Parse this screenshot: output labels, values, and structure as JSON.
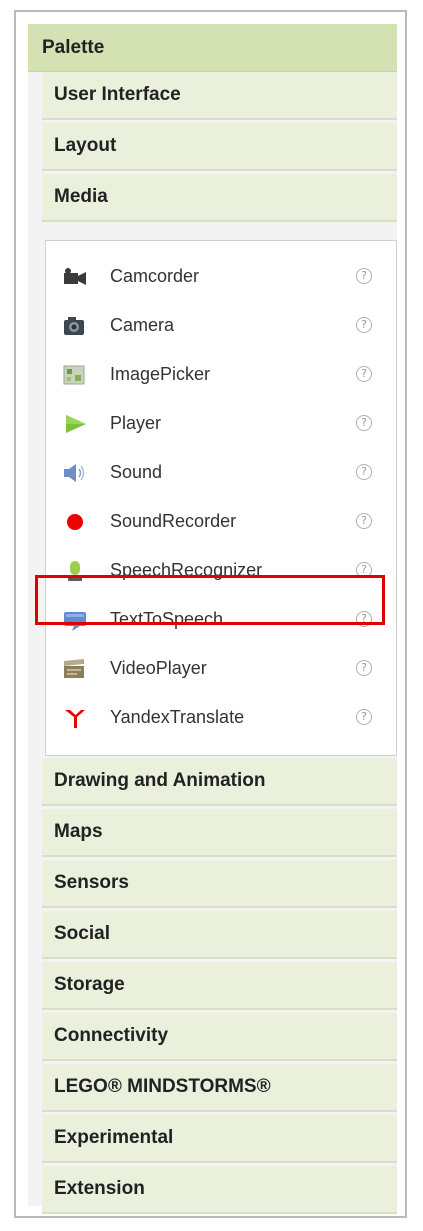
{
  "palette": {
    "title": "Palette"
  },
  "categories_top": [
    "User Interface",
    "Layout",
    "Media"
  ],
  "media_items": [
    {
      "label": "Camcorder",
      "icon": "camcorder-icon"
    },
    {
      "label": "Camera",
      "icon": "camera-icon"
    },
    {
      "label": "ImagePicker",
      "icon": "image-picker-icon"
    },
    {
      "label": "Player",
      "icon": "player-icon"
    },
    {
      "label": "Sound",
      "icon": "sound-icon"
    },
    {
      "label": "SoundRecorder",
      "icon": "sound-recorder-icon"
    },
    {
      "label": "SpeechRecognizer",
      "icon": "speech-recognizer-icon"
    },
    {
      "label": "TextToSpeech",
      "icon": "text-to-speech-icon"
    },
    {
      "label": "VideoPlayer",
      "icon": "video-player-icon"
    },
    {
      "label": "YandexTranslate",
      "icon": "yandex-translate-icon"
    }
  ],
  "help_glyph": "?",
  "categories_bottom": [
    "Drawing and Animation",
    "Maps",
    "Sensors",
    "Social",
    "Storage",
    "Connectivity",
    "LEGO® MINDSTORMS®",
    "Experimental",
    "Extension"
  ],
  "colors": {
    "highlight": "#e10000",
    "header_bg": "#d4e2b3",
    "category_bg": "#eaf0dc"
  }
}
